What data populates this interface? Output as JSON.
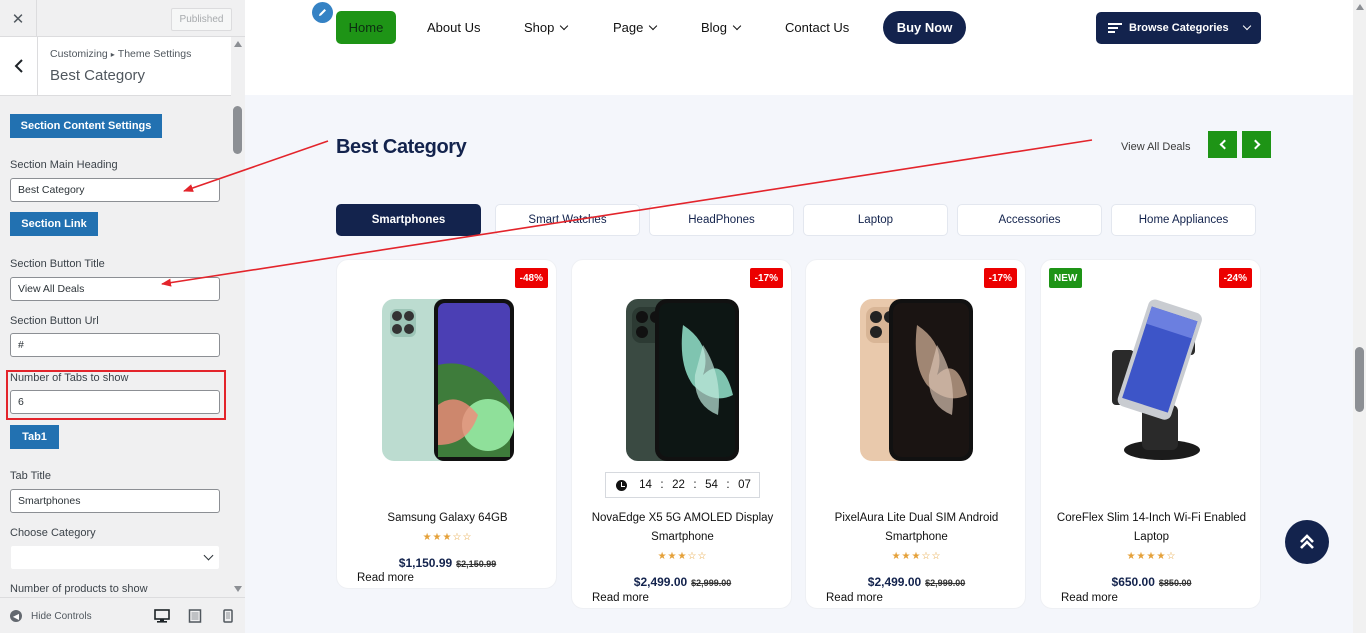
{
  "customizer": {
    "close_icon": "close-icon",
    "published_label": "Published",
    "breadcrumb_root": "Customizing",
    "breadcrumb_sep": "▸",
    "breadcrumb_parent": "Theme Settings",
    "title": "Best Category",
    "section_content_btn": "Section Content Settings",
    "main_heading_label": "Section Main Heading",
    "main_heading_value": "Best Category",
    "section_link_btn": "Section Link",
    "button_title_label": "Section Button Title",
    "button_title_value": "View All Deals",
    "button_url_label": "Section Button Url",
    "button_url_value": "#",
    "tabs_count_label": "Number of Tabs to show",
    "tabs_count_value": "6",
    "tab1_btn": "Tab1",
    "tab_title_label": "Tab Title",
    "tab_title_value": "Smartphones",
    "choose_category_label": "Choose Category",
    "choose_category_value": "",
    "products_count_label": "Number of products to show",
    "hide_controls": "Hide Controls",
    "highlight_color": "#e3242b"
  },
  "nav": {
    "items": [
      "Home",
      "About Us",
      "Shop",
      "Page",
      "Blog",
      "Contact Us"
    ],
    "buy_now": "Buy Now",
    "browse": "Browse Categories"
  },
  "section": {
    "heading": "Best Category",
    "view_all": "View All Deals",
    "tabs": [
      "Smartphones",
      "Smart Watches",
      "HeadPhones",
      "Laptop",
      "Accessories",
      "Home Appliances"
    ],
    "active_tab": "Smartphones"
  },
  "products": [
    {
      "name": "Samsung Galaxy 64GB",
      "badge": "-48%",
      "rating": "★★★☆☆",
      "price": "$1,150.99",
      "old_price": "$2,150.99",
      "read_more": "Read more"
    },
    {
      "name": "NovaEdge X5 5G AMOLED Display Smartphone",
      "badge": "-17%",
      "rating": "★★★☆☆",
      "price": "$2,499.00",
      "old_price": "$2,999.00",
      "read_more": "Read more",
      "timer": {
        "h": "14",
        "m": "22",
        "s": "54",
        "x": "07",
        "sep": ":"
      }
    },
    {
      "name": "PixelAura Lite Dual SIM Android Smartphone",
      "badge": "-17%",
      "rating": "★★★☆☆",
      "price": "$2,499.00",
      "old_price": "$2,999.00",
      "read_more": "Read more"
    },
    {
      "name": "CoreFlex Slim 14-Inch Wi-Fi Enabled Laptop",
      "badge": "-24%",
      "badge_new": "NEW",
      "rating": "★★★★☆",
      "price": "$650.00",
      "old_price": "$850.00",
      "read_more": "Read more"
    }
  ],
  "colors": {
    "navy": "#13234d",
    "green": "#1e9416",
    "sale_red": "#ec0000",
    "wp_blue": "#2271b1"
  }
}
